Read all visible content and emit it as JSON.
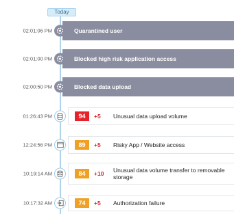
{
  "timeline": {
    "date_label": "Today",
    "actions": [
      {
        "time": "02:01:06 PM",
        "label": "Quarantined user",
        "icon": "gear-icon"
      },
      {
        "time": "02:01:00 PM",
        "label": "Blocked high risk application access",
        "icon": "gear-icon"
      },
      {
        "time": "02:00:50 PM",
        "label": "Blocked data upload",
        "icon": "gear-icon"
      }
    ],
    "alerts": [
      {
        "time": "01:26:43 PM",
        "score": "94",
        "score_color": "#e8222a",
        "delta": "+5",
        "title": "Unusual data upload volume",
        "icon": "database-icon"
      },
      {
        "time": "12:24:56 PM",
        "score": "89",
        "score_color": "#f0a023",
        "delta": "+5",
        "title": "Risky App / Website access",
        "icon": "browser-window-icon"
      },
      {
        "time": "10:19:14 AM",
        "score": "84",
        "score_color": "#f0a023",
        "delta": "+10",
        "title": "Unusual data volume transfer to removable storage",
        "icon": "database-icon"
      },
      {
        "time": "10:17:32 AM",
        "score": "74",
        "score_color": "#f0a023",
        "delta": "+5",
        "title": "Authorization failure",
        "icon": "sign-in-icon"
      }
    ]
  },
  "colors": {
    "action_bar": "#8a8d9f",
    "timeline": "#aed3ea",
    "delta": "#d8262b"
  }
}
